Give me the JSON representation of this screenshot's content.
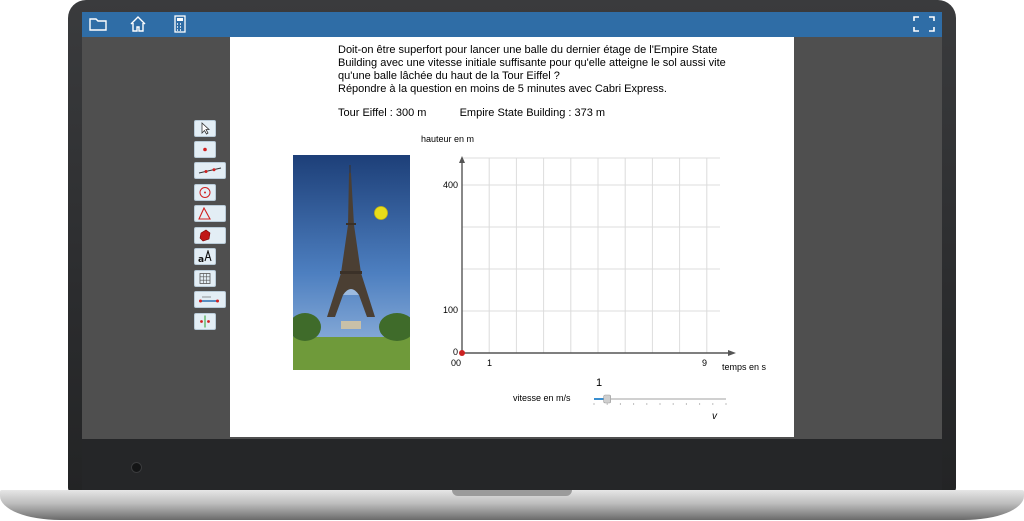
{
  "toolbar": {
    "icons": [
      "folder-icon",
      "home-icon",
      "calculator-icon",
      "fullscreen-icon"
    ],
    "color": "#2f6da6"
  },
  "question": {
    "lines": [
      "Doit-on être superfort pour lancer une balle du dernier étage de l'Empire State",
      "Building avec une vitesse initiale suffisante pour qu'elle atteigne le sol aussi vite",
      "qu'une balle lâchée du haut de la Tour Eiffel ?",
      "Répondre à la question en moins de 5 minutes avec Cabri Express."
    ],
    "eiffel": "Tour Eiffel : 300 m",
    "empire": "Empire State Building : 373 m"
  },
  "tools": [
    "pointer-tool-icon",
    "point-tool-icon",
    "line-tool-icon",
    "circle-tool-icon",
    "polygon-tool-icon",
    "solid-tool-icon",
    "text-tool-icon",
    "grid-tool-icon",
    "measure-tool-icon",
    "transform-tool-icon"
  ],
  "graph": {
    "y_axis_label": "hauteur en m",
    "x_axis_label": "temps en s",
    "y_ticks": [
      "400",
      "100",
      "0"
    ],
    "x_ticks": [
      "0",
      "1",
      "9"
    ],
    "origin_label": "0",
    "point_color": "#cc2222"
  },
  "slider": {
    "label": "vitesse en m/s",
    "value": "1",
    "variable": "v",
    "fraction": 0.1
  }
}
